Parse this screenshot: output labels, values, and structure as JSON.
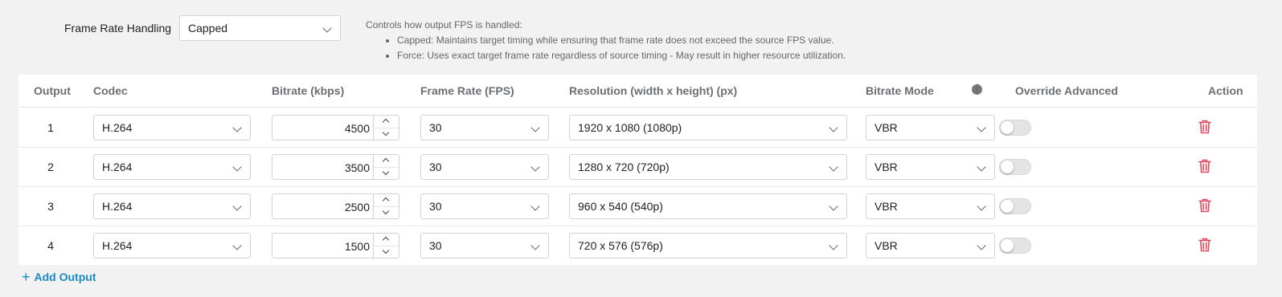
{
  "frame_rate": {
    "label": "Frame Rate Handling",
    "value": "Capped",
    "help_title": "Controls how output FPS is handled:",
    "help_items": [
      "Capped: Maintains target timing while ensuring that frame rate does not exceed the source FPS value.",
      "Force: Uses exact target frame rate regardless of source timing - May result in higher resource utilization."
    ]
  },
  "table": {
    "headers": {
      "output": "Output",
      "codec": "Codec",
      "bitrate": "Bitrate (kbps)",
      "frame_rate": "Frame Rate (FPS)",
      "resolution": "Resolution (width x height) (px)",
      "bitrate_mode": "Bitrate Mode",
      "override": "Override Advanced",
      "action": "Action"
    },
    "rows": [
      {
        "num": "1",
        "codec": "H.264",
        "bitrate": "4500",
        "fps": "30",
        "resolution": "1920 x 1080 (1080p)",
        "mode": "VBR",
        "override": false
      },
      {
        "num": "2",
        "codec": "H.264",
        "bitrate": "3500",
        "fps": "30",
        "resolution": "1280 x 720 (720p)",
        "mode": "VBR",
        "override": false
      },
      {
        "num": "3",
        "codec": "H.264",
        "bitrate": "2500",
        "fps": "30",
        "resolution": "960 x 540 (540p)",
        "mode": "VBR",
        "override": false
      },
      {
        "num": "4",
        "codec": "H.264",
        "bitrate": "1500",
        "fps": "30",
        "resolution": "720 x 576 (576p)",
        "mode": "VBR",
        "override": false
      }
    ]
  },
  "add_output_label": "Add Output",
  "colors": {
    "accent": "#1a8bc2",
    "delete": "#e0485f",
    "toggle_off": "#e2e4e6"
  }
}
